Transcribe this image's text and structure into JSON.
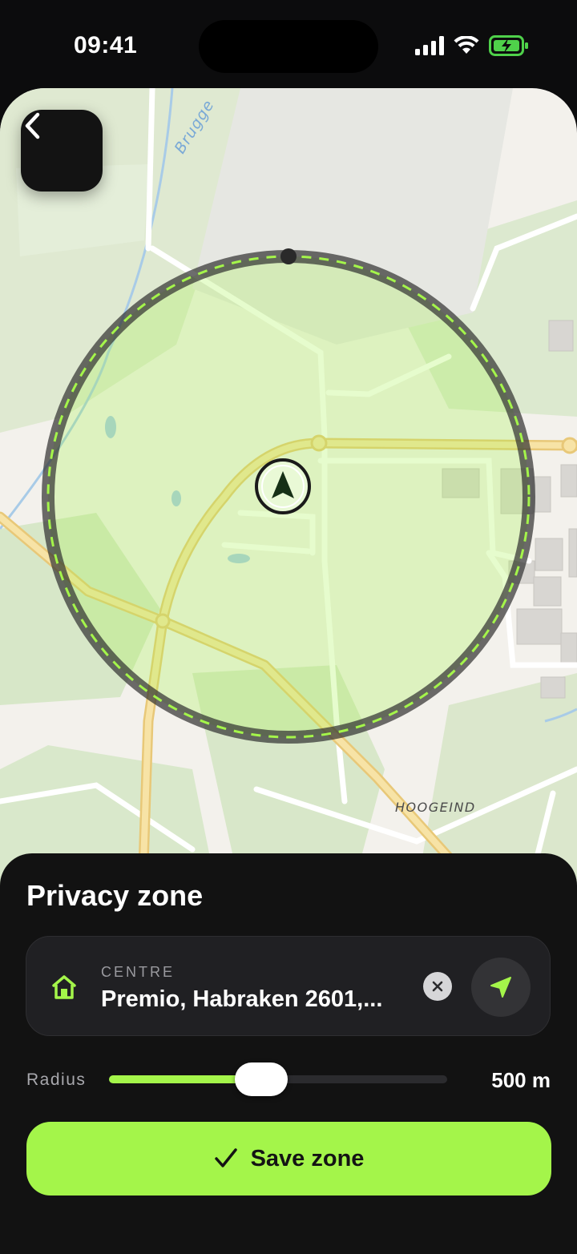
{
  "status_bar": {
    "time": "09:41",
    "icons": [
      "signal-icon",
      "wifi-icon",
      "battery-charging-icon"
    ],
    "battery_color": "#4fd14a"
  },
  "map": {
    "labels": {
      "street": "Brugge",
      "place": "HOOGEIND"
    },
    "zone_color": "#a4f54a",
    "back_icon": "chevron-left-icon",
    "centre_marker_icon": "navigation-arrow-icon"
  },
  "sheet": {
    "title": "Privacy zone",
    "centre": {
      "label": "CENTRE",
      "value": "Premio, Habraken 2601,...",
      "icon": "home-icon",
      "clear_icon": "clear-icon",
      "locate_icon": "location-arrow-icon"
    },
    "radius": {
      "label": "Radius",
      "value_text": "500 m",
      "slider_fraction": 0.45
    },
    "save": {
      "label": "Save zone",
      "icon": "checkmark-icon"
    }
  },
  "colors": {
    "accent": "#a4f54a",
    "sheet_background": "#121212",
    "card_background": "#202023"
  }
}
